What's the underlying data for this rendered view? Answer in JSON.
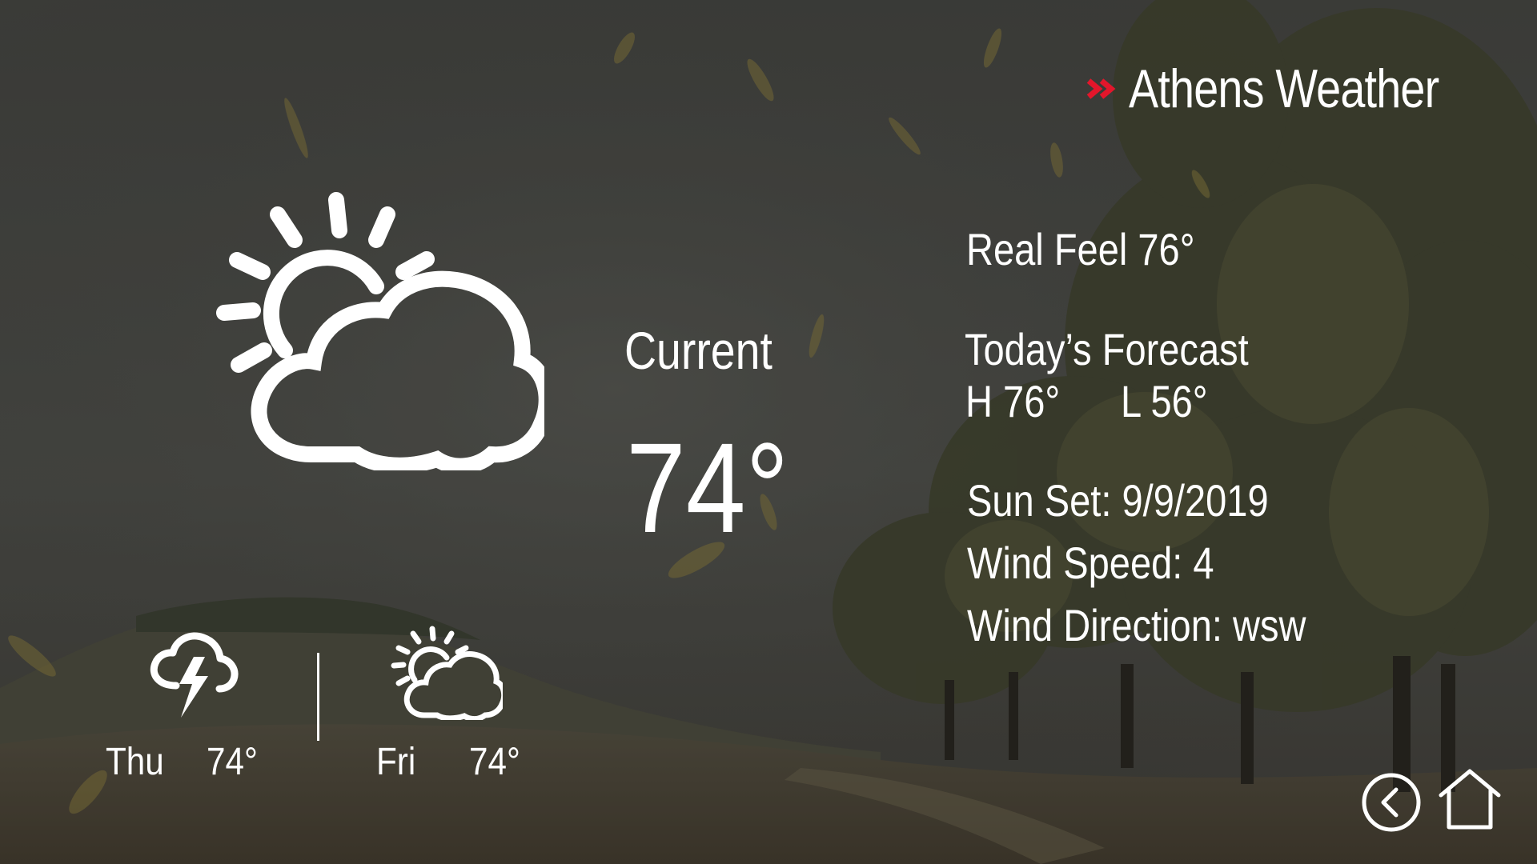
{
  "header": {
    "title": "Athens Weather"
  },
  "current": {
    "label": "Current",
    "temperature": "74°",
    "icon": "partly-cloudy-icon"
  },
  "details": {
    "real_feel": "Real Feel 76°",
    "forecast_label": "Today’s Forecast",
    "high": "H 76°",
    "low": "L 56°",
    "sun_set": "Sun Set:  9/9/2019",
    "wind_speed": "Wind Speed: 4",
    "wind_direction": "Wind Direction: wsw"
  },
  "forecast": [
    {
      "day": "Thu",
      "temp": "74°",
      "icon": "thunderstorm-icon"
    },
    {
      "day": "Fri",
      "temp": "74°",
      "icon": "partly-cloudy-icon"
    }
  ],
  "nav": {
    "back_icon": "back-icon",
    "home_icon": "home-icon"
  },
  "colors": {
    "accent": "#e3162b",
    "text": "#ffffff",
    "overlay": "#3c3d3a"
  }
}
